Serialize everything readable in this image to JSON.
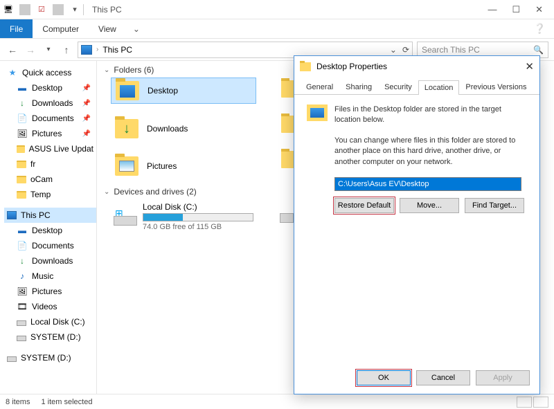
{
  "titlebar": {
    "title": "This PC"
  },
  "ribbon": {
    "file": "File",
    "computer": "Computer",
    "view": "View"
  },
  "nav": {
    "crumb": "This PC",
    "search_placeholder": "Search This PC"
  },
  "sidebar": {
    "quick": "Quick access",
    "items": [
      {
        "label": "Desktop",
        "pin": true
      },
      {
        "label": "Downloads",
        "pin": true
      },
      {
        "label": "Documents",
        "pin": true
      },
      {
        "label": "Pictures",
        "pin": true
      },
      {
        "label": "ASUS Live Updat",
        "pin": false
      },
      {
        "label": "fr",
        "pin": false
      },
      {
        "label": "oCam",
        "pin": false
      },
      {
        "label": "Temp",
        "pin": false
      }
    ],
    "thispc": "This PC",
    "pc_items": [
      "Desktop",
      "Documents",
      "Downloads",
      "Music",
      "Pictures",
      "Videos",
      "Local Disk (C:)",
      "SYSTEM (D:)"
    ],
    "system2": "SYSTEM (D:)"
  },
  "content": {
    "folders_hdr": "Folders (6)",
    "folders": [
      "Desktop",
      "Downloads",
      "Pictures"
    ],
    "drives_hdr": "Devices and drives (2)",
    "drive": {
      "name": "Local Disk (C:)",
      "free": "74.0 GB free of 115 GB"
    }
  },
  "status": {
    "count": "8 items",
    "selected": "1 item selected"
  },
  "dialog": {
    "title": "Desktop Properties",
    "tabs": [
      "General",
      "Sharing",
      "Security",
      "Location",
      "Previous Versions"
    ],
    "active_tab": "Location",
    "line1": "Files in the Desktop folder are stored in the target location below.",
    "explain": "You can change where files in this folder are stored to another place on this hard drive, another drive, or another computer on your network.",
    "path": "C:\\Users\\Asus EV\\Desktop",
    "restore": "Restore Default",
    "move": "Move...",
    "find": "Find Target...",
    "ok": "OK",
    "cancel": "Cancel",
    "apply": "Apply"
  }
}
